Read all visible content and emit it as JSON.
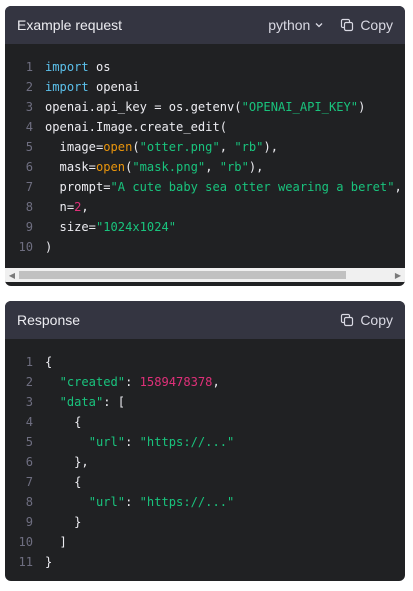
{
  "request": {
    "title": "Example request",
    "language": "python",
    "copy_label": "Copy",
    "scroll_position": 0.88,
    "lines": [
      {
        "n": "1",
        "tokens": [
          {
            "t": "import",
            "c": "kw"
          },
          {
            "t": " os",
            "c": "plain"
          }
        ]
      },
      {
        "n": "2",
        "tokens": [
          {
            "t": "import",
            "c": "kw"
          },
          {
            "t": " openai",
            "c": "plain"
          }
        ]
      },
      {
        "n": "3",
        "tokens": [
          {
            "t": "openai.api_key = os.getenv(",
            "c": "plain"
          },
          {
            "t": "\"OPENAI_API_KEY\"",
            "c": "str"
          },
          {
            "t": ")",
            "c": "plain"
          }
        ]
      },
      {
        "n": "4",
        "tokens": [
          {
            "t": "openai.Image.create_edit(",
            "c": "plain"
          }
        ]
      },
      {
        "n": "5",
        "tokens": [
          {
            "t": "  image=",
            "c": "plain"
          },
          {
            "t": "open",
            "c": "fn"
          },
          {
            "t": "(",
            "c": "plain"
          },
          {
            "t": "\"otter.png\"",
            "c": "str"
          },
          {
            "t": ", ",
            "c": "plain"
          },
          {
            "t": "\"rb\"",
            "c": "str"
          },
          {
            "t": "),",
            "c": "plain"
          }
        ]
      },
      {
        "n": "6",
        "tokens": [
          {
            "t": "  mask=",
            "c": "plain"
          },
          {
            "t": "open",
            "c": "fn"
          },
          {
            "t": "(",
            "c": "plain"
          },
          {
            "t": "\"mask.png\"",
            "c": "str"
          },
          {
            "t": ", ",
            "c": "plain"
          },
          {
            "t": "\"rb\"",
            "c": "str"
          },
          {
            "t": "),",
            "c": "plain"
          }
        ]
      },
      {
        "n": "7",
        "tokens": [
          {
            "t": "  prompt=",
            "c": "plain"
          },
          {
            "t": "\"A cute baby sea otter wearing a beret\"",
            "c": "str"
          },
          {
            "t": ",",
            "c": "plain"
          }
        ]
      },
      {
        "n": "8",
        "tokens": [
          {
            "t": "  n=",
            "c": "plain"
          },
          {
            "t": "2",
            "c": "num"
          },
          {
            "t": ",",
            "c": "plain"
          }
        ]
      },
      {
        "n": "9",
        "tokens": [
          {
            "t": "  size=",
            "c": "plain"
          },
          {
            "t": "\"1024x1024\"",
            "c": "str"
          }
        ]
      },
      {
        "n": "10",
        "tokens": [
          {
            "t": ")",
            "c": "plain"
          }
        ]
      }
    ]
  },
  "response": {
    "title": "Response",
    "copy_label": "Copy",
    "lines": [
      {
        "n": "1",
        "tokens": [
          {
            "t": "{",
            "c": "plain"
          }
        ]
      },
      {
        "n": "2",
        "tokens": [
          {
            "t": "  ",
            "c": "plain"
          },
          {
            "t": "\"created\"",
            "c": "str"
          },
          {
            "t": ": ",
            "c": "plain"
          },
          {
            "t": "1589478378",
            "c": "num"
          },
          {
            "t": ",",
            "c": "plain"
          }
        ]
      },
      {
        "n": "3",
        "tokens": [
          {
            "t": "  ",
            "c": "plain"
          },
          {
            "t": "\"data\"",
            "c": "str"
          },
          {
            "t": ": [",
            "c": "plain"
          }
        ]
      },
      {
        "n": "4",
        "tokens": [
          {
            "t": "    {",
            "c": "plain"
          }
        ]
      },
      {
        "n": "5",
        "tokens": [
          {
            "t": "      ",
            "c": "plain"
          },
          {
            "t": "\"url\"",
            "c": "str"
          },
          {
            "t": ": ",
            "c": "plain"
          },
          {
            "t": "\"https://...\"",
            "c": "str"
          }
        ]
      },
      {
        "n": "6",
        "tokens": [
          {
            "t": "    },",
            "c": "plain"
          }
        ]
      },
      {
        "n": "7",
        "tokens": [
          {
            "t": "    {",
            "c": "plain"
          }
        ]
      },
      {
        "n": "8",
        "tokens": [
          {
            "t": "      ",
            "c": "plain"
          },
          {
            "t": "\"url\"",
            "c": "str"
          },
          {
            "t": ": ",
            "c": "plain"
          },
          {
            "t": "\"https://...\"",
            "c": "str"
          }
        ]
      },
      {
        "n": "9",
        "tokens": [
          {
            "t": "    }",
            "c": "plain"
          }
        ]
      },
      {
        "n": "10",
        "tokens": [
          {
            "t": "  ]",
            "c": "plain"
          }
        ]
      },
      {
        "n": "11",
        "tokens": [
          {
            "t": "}",
            "c": "plain"
          }
        ]
      }
    ]
  },
  "icons": {
    "copy": "copy-icon",
    "chevron": "chevron-down-icon",
    "scroll_left": "scroll-left-arrow-icon",
    "scroll_right": "scroll-right-arrow-icon"
  },
  "colors": {
    "panel_bg": "#202123",
    "header_bg": "#343541",
    "keyword": "#5bc0eb",
    "string": "#19c37d",
    "number": "#df3079",
    "function": "#e9950c"
  }
}
